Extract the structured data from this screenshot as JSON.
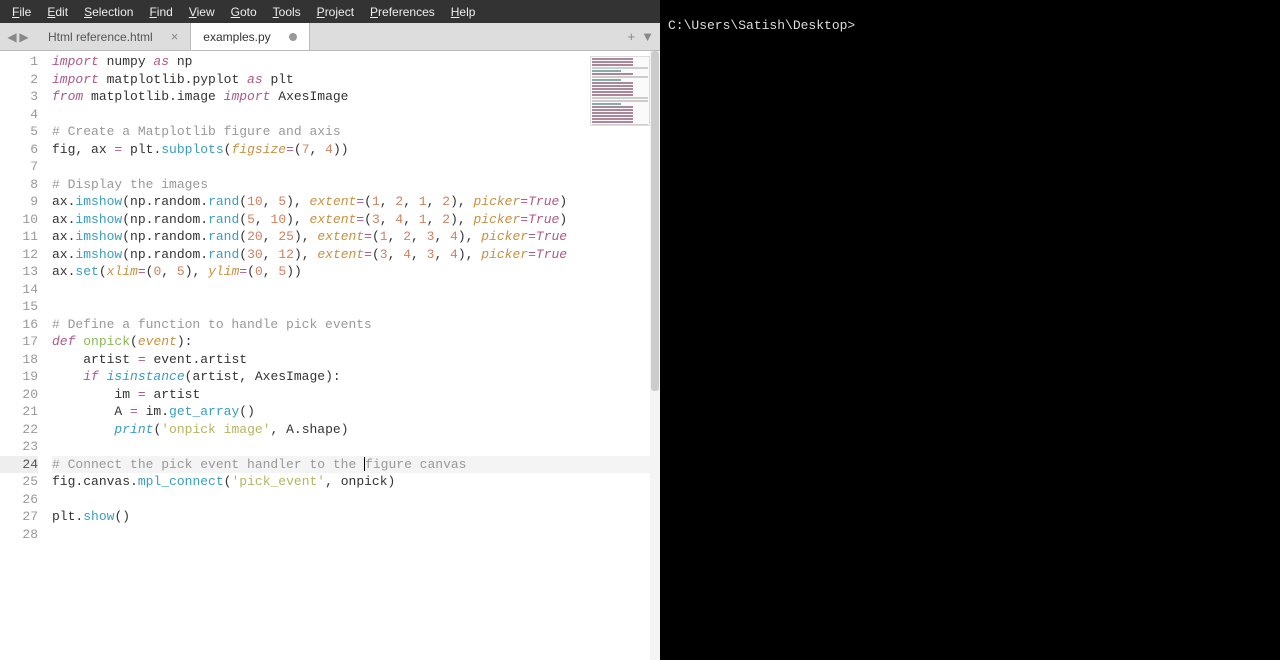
{
  "menubar": {
    "items": [
      "File",
      "Edit",
      "Selection",
      "Find",
      "View",
      "Goto",
      "Tools",
      "Project",
      "Preferences",
      "Help"
    ]
  },
  "tabs": [
    {
      "label": "Html reference.html",
      "active": false,
      "modified": false
    },
    {
      "label": "examples.py",
      "active": true,
      "modified": true
    }
  ],
  "nav": {
    "left": "◀",
    "right": "▶",
    "plus": "+",
    "dropdown": "▼"
  },
  "terminal": {
    "prompt": "C:\\Users\\Satish\\Desktop>"
  },
  "active_line": 24,
  "code_lines": [
    {
      "n": 1,
      "tokens": [
        {
          "t": "import ",
          "c": "kw"
        },
        {
          "t": "numpy ",
          "c": "name"
        },
        {
          "t": "as ",
          "c": "kw"
        },
        {
          "t": "np",
          "c": "name"
        }
      ]
    },
    {
      "n": 2,
      "tokens": [
        {
          "t": "import ",
          "c": "kw"
        },
        {
          "t": "matplotlib",
          "c": "name"
        },
        {
          "t": ".",
          "c": "punc"
        },
        {
          "t": "pyplot ",
          "c": "name"
        },
        {
          "t": "as ",
          "c": "kw"
        },
        {
          "t": "plt",
          "c": "name"
        }
      ]
    },
    {
      "n": 3,
      "tokens": [
        {
          "t": "from ",
          "c": "kw"
        },
        {
          "t": "matplotlib",
          "c": "name"
        },
        {
          "t": ".",
          "c": "punc"
        },
        {
          "t": "image ",
          "c": "name"
        },
        {
          "t": "import ",
          "c": "kw"
        },
        {
          "t": "AxesImage",
          "c": "name"
        }
      ]
    },
    {
      "n": 4,
      "tokens": []
    },
    {
      "n": 5,
      "tokens": [
        {
          "t": "# Create a Matplotlib figure and axis",
          "c": "cmt"
        }
      ]
    },
    {
      "n": 6,
      "tokens": [
        {
          "t": "fig",
          "c": "name"
        },
        {
          "t": ", ",
          "c": "punc"
        },
        {
          "t": "ax ",
          "c": "name"
        },
        {
          "t": "= ",
          "c": "op"
        },
        {
          "t": "plt",
          "c": "name"
        },
        {
          "t": ".",
          "c": "punc"
        },
        {
          "t": "subplots",
          "c": "fn"
        },
        {
          "t": "(",
          "c": "punc"
        },
        {
          "t": "figsize",
          "c": "param"
        },
        {
          "t": "=",
          "c": "op"
        },
        {
          "t": "(",
          "c": "punc"
        },
        {
          "t": "7",
          "c": "num"
        },
        {
          "t": ", ",
          "c": "punc"
        },
        {
          "t": "4",
          "c": "num"
        },
        {
          "t": "))",
          "c": "punc"
        }
      ]
    },
    {
      "n": 7,
      "tokens": []
    },
    {
      "n": 8,
      "tokens": [
        {
          "t": "# Display the images",
          "c": "cmt"
        }
      ]
    },
    {
      "n": 9,
      "tokens": [
        {
          "t": "ax",
          "c": "name"
        },
        {
          "t": ".",
          "c": "punc"
        },
        {
          "t": "imshow",
          "c": "fn"
        },
        {
          "t": "(np",
          "c": "punc"
        },
        {
          "t": ".",
          "c": "punc"
        },
        {
          "t": "random",
          "c": "name"
        },
        {
          "t": ".",
          "c": "punc"
        },
        {
          "t": "rand",
          "c": "fn"
        },
        {
          "t": "(",
          "c": "punc"
        },
        {
          "t": "10",
          "c": "num"
        },
        {
          "t": ", ",
          "c": "punc"
        },
        {
          "t": "5",
          "c": "num"
        },
        {
          "t": "), ",
          "c": "punc"
        },
        {
          "t": "extent",
          "c": "param"
        },
        {
          "t": "=",
          "c": "op"
        },
        {
          "t": "(",
          "c": "punc"
        },
        {
          "t": "1",
          "c": "num"
        },
        {
          "t": ", ",
          "c": "punc"
        },
        {
          "t": "2",
          "c": "num"
        },
        {
          "t": ", ",
          "c": "punc"
        },
        {
          "t": "1",
          "c": "num"
        },
        {
          "t": ", ",
          "c": "punc"
        },
        {
          "t": "2",
          "c": "num"
        },
        {
          "t": "), ",
          "c": "punc"
        },
        {
          "t": "picker",
          "c": "param"
        },
        {
          "t": "=",
          "c": "op"
        },
        {
          "t": "True",
          "c": "const"
        },
        {
          "t": ")",
          "c": "punc"
        }
      ]
    },
    {
      "n": 10,
      "tokens": [
        {
          "t": "ax",
          "c": "name"
        },
        {
          "t": ".",
          "c": "punc"
        },
        {
          "t": "imshow",
          "c": "fn"
        },
        {
          "t": "(np",
          "c": "punc"
        },
        {
          "t": ".",
          "c": "punc"
        },
        {
          "t": "random",
          "c": "name"
        },
        {
          "t": ".",
          "c": "punc"
        },
        {
          "t": "rand",
          "c": "fn"
        },
        {
          "t": "(",
          "c": "punc"
        },
        {
          "t": "5",
          "c": "num"
        },
        {
          "t": ", ",
          "c": "punc"
        },
        {
          "t": "10",
          "c": "num"
        },
        {
          "t": "), ",
          "c": "punc"
        },
        {
          "t": "extent",
          "c": "param"
        },
        {
          "t": "=",
          "c": "op"
        },
        {
          "t": "(",
          "c": "punc"
        },
        {
          "t": "3",
          "c": "num"
        },
        {
          "t": ", ",
          "c": "punc"
        },
        {
          "t": "4",
          "c": "num"
        },
        {
          "t": ", ",
          "c": "punc"
        },
        {
          "t": "1",
          "c": "num"
        },
        {
          "t": ", ",
          "c": "punc"
        },
        {
          "t": "2",
          "c": "num"
        },
        {
          "t": "), ",
          "c": "punc"
        },
        {
          "t": "picker",
          "c": "param"
        },
        {
          "t": "=",
          "c": "op"
        },
        {
          "t": "True",
          "c": "const"
        },
        {
          "t": ")",
          "c": "punc"
        }
      ]
    },
    {
      "n": 11,
      "tokens": [
        {
          "t": "ax",
          "c": "name"
        },
        {
          "t": ".",
          "c": "punc"
        },
        {
          "t": "imshow",
          "c": "fn"
        },
        {
          "t": "(np",
          "c": "punc"
        },
        {
          "t": ".",
          "c": "punc"
        },
        {
          "t": "random",
          "c": "name"
        },
        {
          "t": ".",
          "c": "punc"
        },
        {
          "t": "rand",
          "c": "fn"
        },
        {
          "t": "(",
          "c": "punc"
        },
        {
          "t": "20",
          "c": "num"
        },
        {
          "t": ", ",
          "c": "punc"
        },
        {
          "t": "25",
          "c": "num"
        },
        {
          "t": "), ",
          "c": "punc"
        },
        {
          "t": "extent",
          "c": "param"
        },
        {
          "t": "=",
          "c": "op"
        },
        {
          "t": "(",
          "c": "punc"
        },
        {
          "t": "1",
          "c": "num"
        },
        {
          "t": ", ",
          "c": "punc"
        },
        {
          "t": "2",
          "c": "num"
        },
        {
          "t": ", ",
          "c": "punc"
        },
        {
          "t": "3",
          "c": "num"
        },
        {
          "t": ", ",
          "c": "punc"
        },
        {
          "t": "4",
          "c": "num"
        },
        {
          "t": "), ",
          "c": "punc"
        },
        {
          "t": "picker",
          "c": "param"
        },
        {
          "t": "=",
          "c": "op"
        },
        {
          "t": "True",
          "c": "const"
        }
      ]
    },
    {
      "n": 12,
      "tokens": [
        {
          "t": "ax",
          "c": "name"
        },
        {
          "t": ".",
          "c": "punc"
        },
        {
          "t": "imshow",
          "c": "fn"
        },
        {
          "t": "(np",
          "c": "punc"
        },
        {
          "t": ".",
          "c": "punc"
        },
        {
          "t": "random",
          "c": "name"
        },
        {
          "t": ".",
          "c": "punc"
        },
        {
          "t": "rand",
          "c": "fn"
        },
        {
          "t": "(",
          "c": "punc"
        },
        {
          "t": "30",
          "c": "num"
        },
        {
          "t": ", ",
          "c": "punc"
        },
        {
          "t": "12",
          "c": "num"
        },
        {
          "t": "), ",
          "c": "punc"
        },
        {
          "t": "extent",
          "c": "param"
        },
        {
          "t": "=",
          "c": "op"
        },
        {
          "t": "(",
          "c": "punc"
        },
        {
          "t": "3",
          "c": "num"
        },
        {
          "t": ", ",
          "c": "punc"
        },
        {
          "t": "4",
          "c": "num"
        },
        {
          "t": ", ",
          "c": "punc"
        },
        {
          "t": "3",
          "c": "num"
        },
        {
          "t": ", ",
          "c": "punc"
        },
        {
          "t": "4",
          "c": "num"
        },
        {
          "t": "), ",
          "c": "punc"
        },
        {
          "t": "picker",
          "c": "param"
        },
        {
          "t": "=",
          "c": "op"
        },
        {
          "t": "True",
          "c": "const"
        }
      ]
    },
    {
      "n": 13,
      "tokens": [
        {
          "t": "ax",
          "c": "name"
        },
        {
          "t": ".",
          "c": "punc"
        },
        {
          "t": "set",
          "c": "fn"
        },
        {
          "t": "(",
          "c": "punc"
        },
        {
          "t": "xlim",
          "c": "param"
        },
        {
          "t": "=",
          "c": "op"
        },
        {
          "t": "(",
          "c": "punc"
        },
        {
          "t": "0",
          "c": "num"
        },
        {
          "t": ", ",
          "c": "punc"
        },
        {
          "t": "5",
          "c": "num"
        },
        {
          "t": "), ",
          "c": "punc"
        },
        {
          "t": "ylim",
          "c": "param"
        },
        {
          "t": "=",
          "c": "op"
        },
        {
          "t": "(",
          "c": "punc"
        },
        {
          "t": "0",
          "c": "num"
        },
        {
          "t": ", ",
          "c": "punc"
        },
        {
          "t": "5",
          "c": "num"
        },
        {
          "t": "))",
          "c": "punc"
        }
      ]
    },
    {
      "n": 14,
      "tokens": []
    },
    {
      "n": 15,
      "tokens": []
    },
    {
      "n": 16,
      "tokens": [
        {
          "t": "# Define a function to handle pick events",
          "c": "cmt"
        }
      ]
    },
    {
      "n": 17,
      "tokens": [
        {
          "t": "def ",
          "c": "kw"
        },
        {
          "t": "onpick",
          "c": "def-name"
        },
        {
          "t": "(",
          "c": "punc"
        },
        {
          "t": "event",
          "c": "param"
        },
        {
          "t": "):",
          "c": "punc"
        }
      ]
    },
    {
      "n": 18,
      "tokens": [
        {
          "t": "    artist ",
          "c": "name"
        },
        {
          "t": "= ",
          "c": "op"
        },
        {
          "t": "event",
          "c": "name"
        },
        {
          "t": ".",
          "c": "punc"
        },
        {
          "t": "artist",
          "c": "name"
        }
      ]
    },
    {
      "n": 19,
      "tokens": [
        {
          "t": "    ",
          "c": "name"
        },
        {
          "t": "if ",
          "c": "kw"
        },
        {
          "t": "isinstance",
          "c": "builtin"
        },
        {
          "t": "(artist, AxesImage):",
          "c": "punc"
        }
      ]
    },
    {
      "n": 20,
      "tokens": [
        {
          "t": "        im ",
          "c": "name"
        },
        {
          "t": "= ",
          "c": "op"
        },
        {
          "t": "artist",
          "c": "name"
        }
      ]
    },
    {
      "n": 21,
      "tokens": [
        {
          "t": "        A ",
          "c": "name"
        },
        {
          "t": "= ",
          "c": "op"
        },
        {
          "t": "im",
          "c": "name"
        },
        {
          "t": ".",
          "c": "punc"
        },
        {
          "t": "get_array",
          "c": "fn"
        },
        {
          "t": "()",
          "c": "punc"
        }
      ]
    },
    {
      "n": 22,
      "tokens": [
        {
          "t": "        ",
          "c": "name"
        },
        {
          "t": "print",
          "c": "fn-it"
        },
        {
          "t": "(",
          "c": "punc"
        },
        {
          "t": "'onpick image'",
          "c": "str"
        },
        {
          "t": ", A",
          "c": "punc"
        },
        {
          "t": ".",
          "c": "punc"
        },
        {
          "t": "shape)",
          "c": "punc"
        }
      ]
    },
    {
      "n": 23,
      "tokens": []
    },
    {
      "n": 24,
      "tokens": [
        {
          "t": "# Connect the pick event handler to the ",
          "c": "cmt"
        },
        {
          "t": "|",
          "c": "caret-marker"
        },
        {
          "t": "figure canvas",
          "c": "cmt"
        }
      ]
    },
    {
      "n": 25,
      "tokens": [
        {
          "t": "fig",
          "c": "name"
        },
        {
          "t": ".",
          "c": "punc"
        },
        {
          "t": "canvas",
          "c": "name"
        },
        {
          "t": ".",
          "c": "punc"
        },
        {
          "t": "mpl_connect",
          "c": "fn"
        },
        {
          "t": "(",
          "c": "punc"
        },
        {
          "t": "'pick_event'",
          "c": "str"
        },
        {
          "t": ", onpick)",
          "c": "punc"
        }
      ]
    },
    {
      "n": 26,
      "tokens": []
    },
    {
      "n": 27,
      "tokens": [
        {
          "t": "plt",
          "c": "name"
        },
        {
          "t": ".",
          "c": "punc"
        },
        {
          "t": "show",
          "c": "fn"
        },
        {
          "t": "()",
          "c": "punc"
        }
      ]
    },
    {
      "n": 28,
      "tokens": []
    }
  ]
}
